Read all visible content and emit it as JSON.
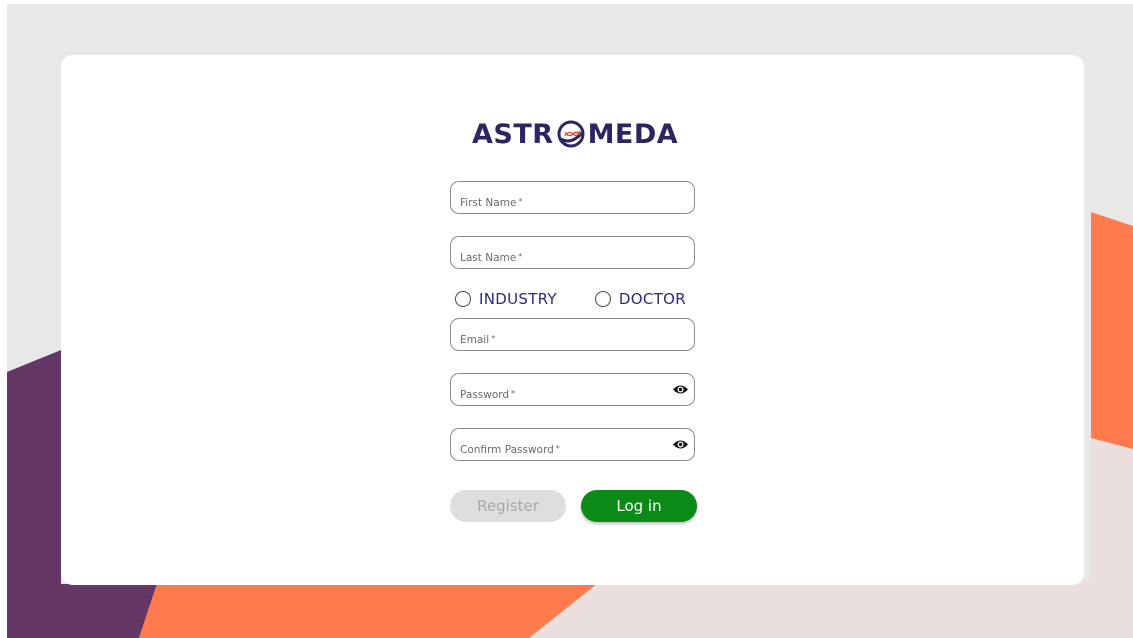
{
  "brand": {
    "name_part1": "ASTR",
    "name_part2": "MEDA"
  },
  "form": {
    "first_name": {
      "placeholder": "First Name",
      "required_mark": "*",
      "value": ""
    },
    "last_name": {
      "placeholder": "Last Name",
      "required_mark": "*",
      "value": ""
    },
    "role_options": [
      {
        "label": "INDUSTRY",
        "selected": false
      },
      {
        "label": "DOCTOR",
        "selected": false
      }
    ],
    "email": {
      "placeholder": "Email",
      "required_mark": "*",
      "value": ""
    },
    "password": {
      "placeholder": "Password",
      "required_mark": "*",
      "value": "",
      "toggle_icon": "eye-icon"
    },
    "confirm_password": {
      "placeholder": "Confirm Password",
      "required_mark": "*",
      "value": "",
      "toggle_icon": "eye-icon"
    }
  },
  "buttons": {
    "register_label": "Register",
    "login_label": "Log in"
  },
  "colors": {
    "brand_navy": "#2b2660",
    "radio_label": "#2e2a7a",
    "login_green": "#0c8a17",
    "register_disabled_bg": "#dedede",
    "bg_orange": "#ff7b4d",
    "bg_purple": "#643766",
    "bg_grey": "#e8e8e8",
    "bg_pink": "#ebdfdd"
  }
}
